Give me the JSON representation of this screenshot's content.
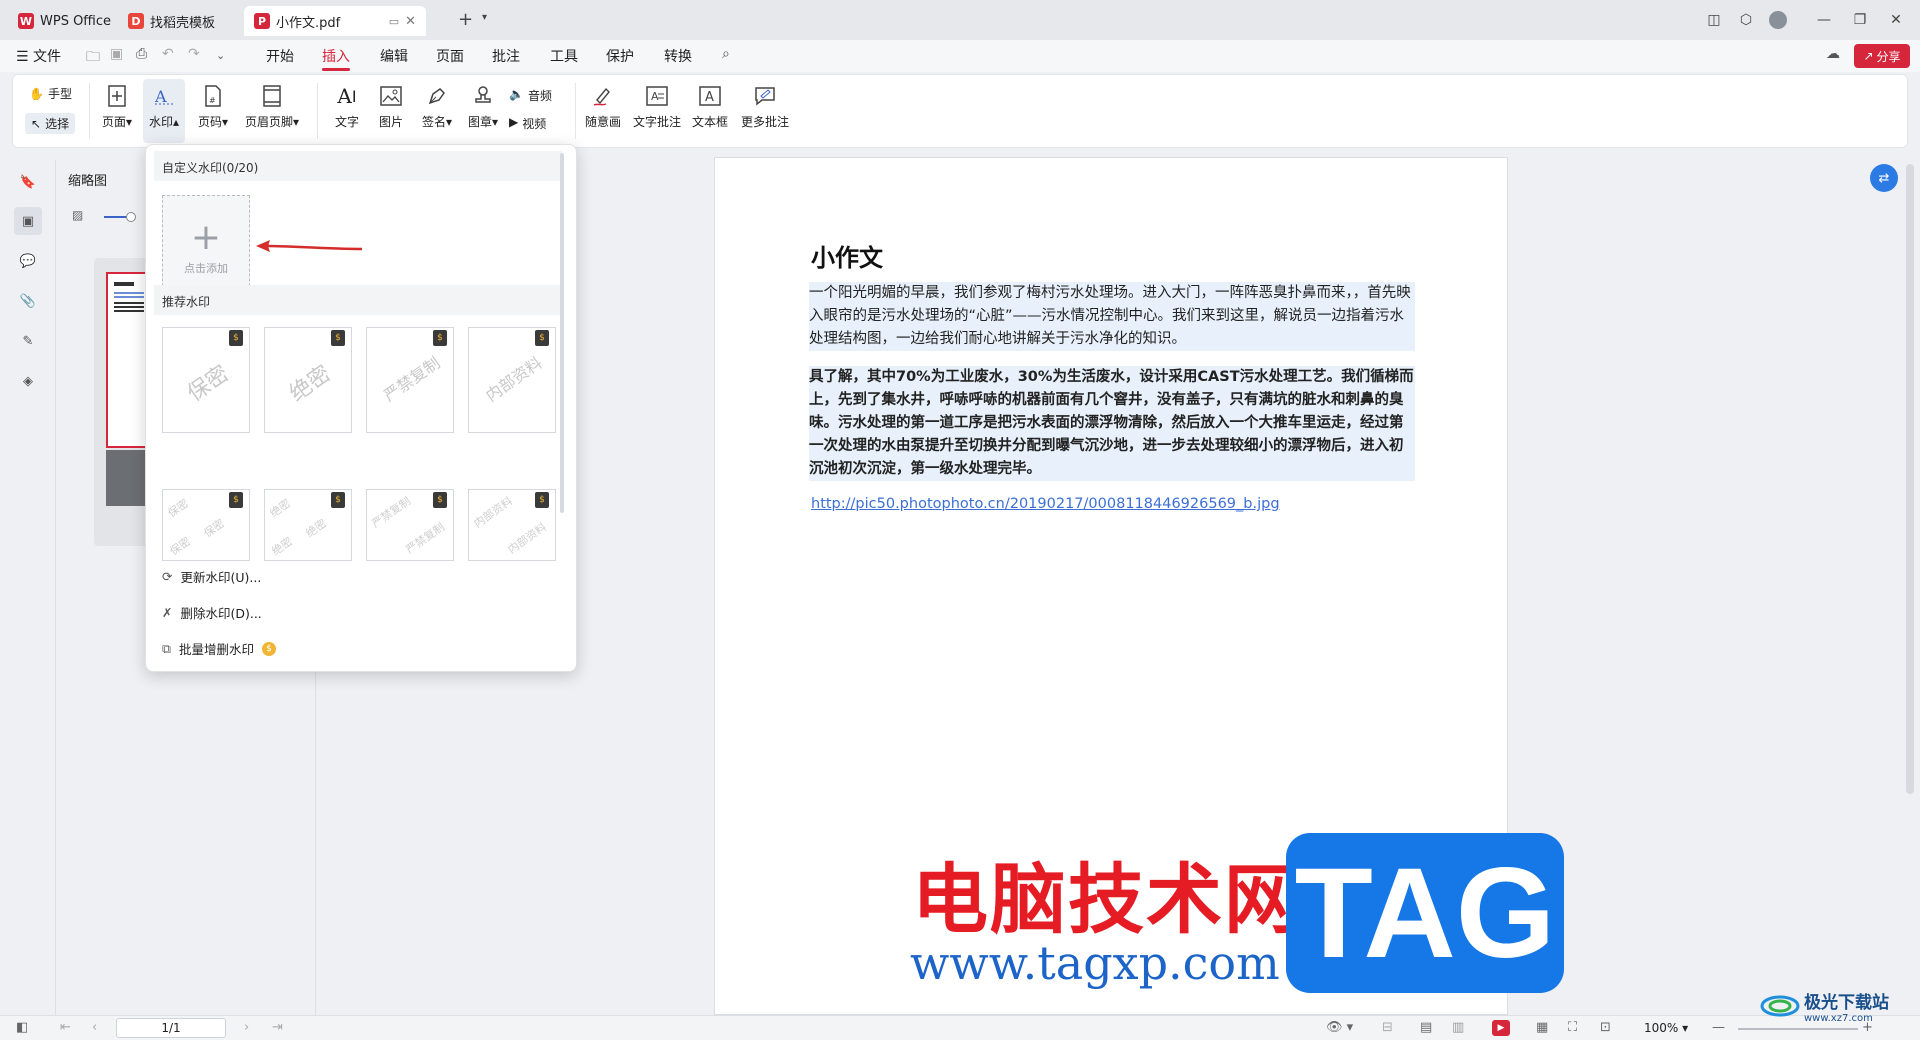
{
  "tabs": [
    {
      "label": "WPS Office"
    },
    {
      "label": "找稻壳模板"
    },
    {
      "label": "小作文.pdf"
    }
  ],
  "menu": {
    "file": "文件",
    "items": [
      "开始",
      "插入",
      "编辑",
      "页面",
      "批注",
      "工具",
      "保护",
      "转换"
    ],
    "active": "插入",
    "share": "分享"
  },
  "ribbon": {
    "hand": "手型",
    "select": "选择",
    "page": "页面",
    "watermark": "水印",
    "page_number": "页码",
    "header_footer": "页眉页脚",
    "text": "文字",
    "image": "图片",
    "signature": "签名",
    "stamp": "图章",
    "audio": "音频",
    "video": "视频",
    "freehand": "随意画",
    "text_comment": "文字批注",
    "textbox": "文本框",
    "more_comments": "更多批注"
  },
  "thumb_panel": {
    "title": "缩略图"
  },
  "dropdown": {
    "custom_header": "自定义水印(0/20)",
    "add_label": "点击添加",
    "recommended_header": "推荐水印",
    "presets": [
      "保密",
      "绝密",
      "严禁复制",
      "内部资料"
    ],
    "actions": {
      "update": "更新水印(U)...",
      "delete": "删除水印(D)...",
      "batch": "批量增删水印"
    }
  },
  "document": {
    "title": "小作文",
    "para1": "一个阳光明媚的早晨，我们参观了梅村污水处理场。进入大门，一阵阵恶臭扑鼻而来，，首先映入眼帘的是污水处理场的“心脏”——污水情况控制中心。我们来到这里，解说员一边指着污水处理结构图，一边给我们耐心地讲解关于污水净化的知识。",
    "para2": "具了解，其中70%为工业废水，30%为生活废水，设计采用CAST污水处理工艺。我们循梯而上，先到了集水井，呼哧呼哧的机器前面有几个窨井，没有盖子，只有满坑的脏水和刺鼻的臭味。污水处理的第一道工序是把污水表面的漂浮物清除，然后放入一个大推车里运走，经过第一次处理的水由泵提升至切换井分配到曝气沉沙地，进一步去处理较细小的漂浮物后，进入初沉池初次沉淀，第一级水处理完毕。",
    "link": "http://pic50.photophoto.cn/20190217/0008118446926569_b.jpg"
  },
  "statusbar": {
    "page_value": "1/1",
    "zoom": "100%"
  },
  "overlay": {
    "cn_text": "电脑技术网",
    "url_text": "www.tagxp.com",
    "tag_text": "TAG",
    "corner_text": "极光下载站",
    "corner_url": "www.xz7.com"
  },
  "colors": {
    "accent": "#d6263b",
    "link": "#3b6fd6",
    "highlight": "#e8f1fb"
  }
}
